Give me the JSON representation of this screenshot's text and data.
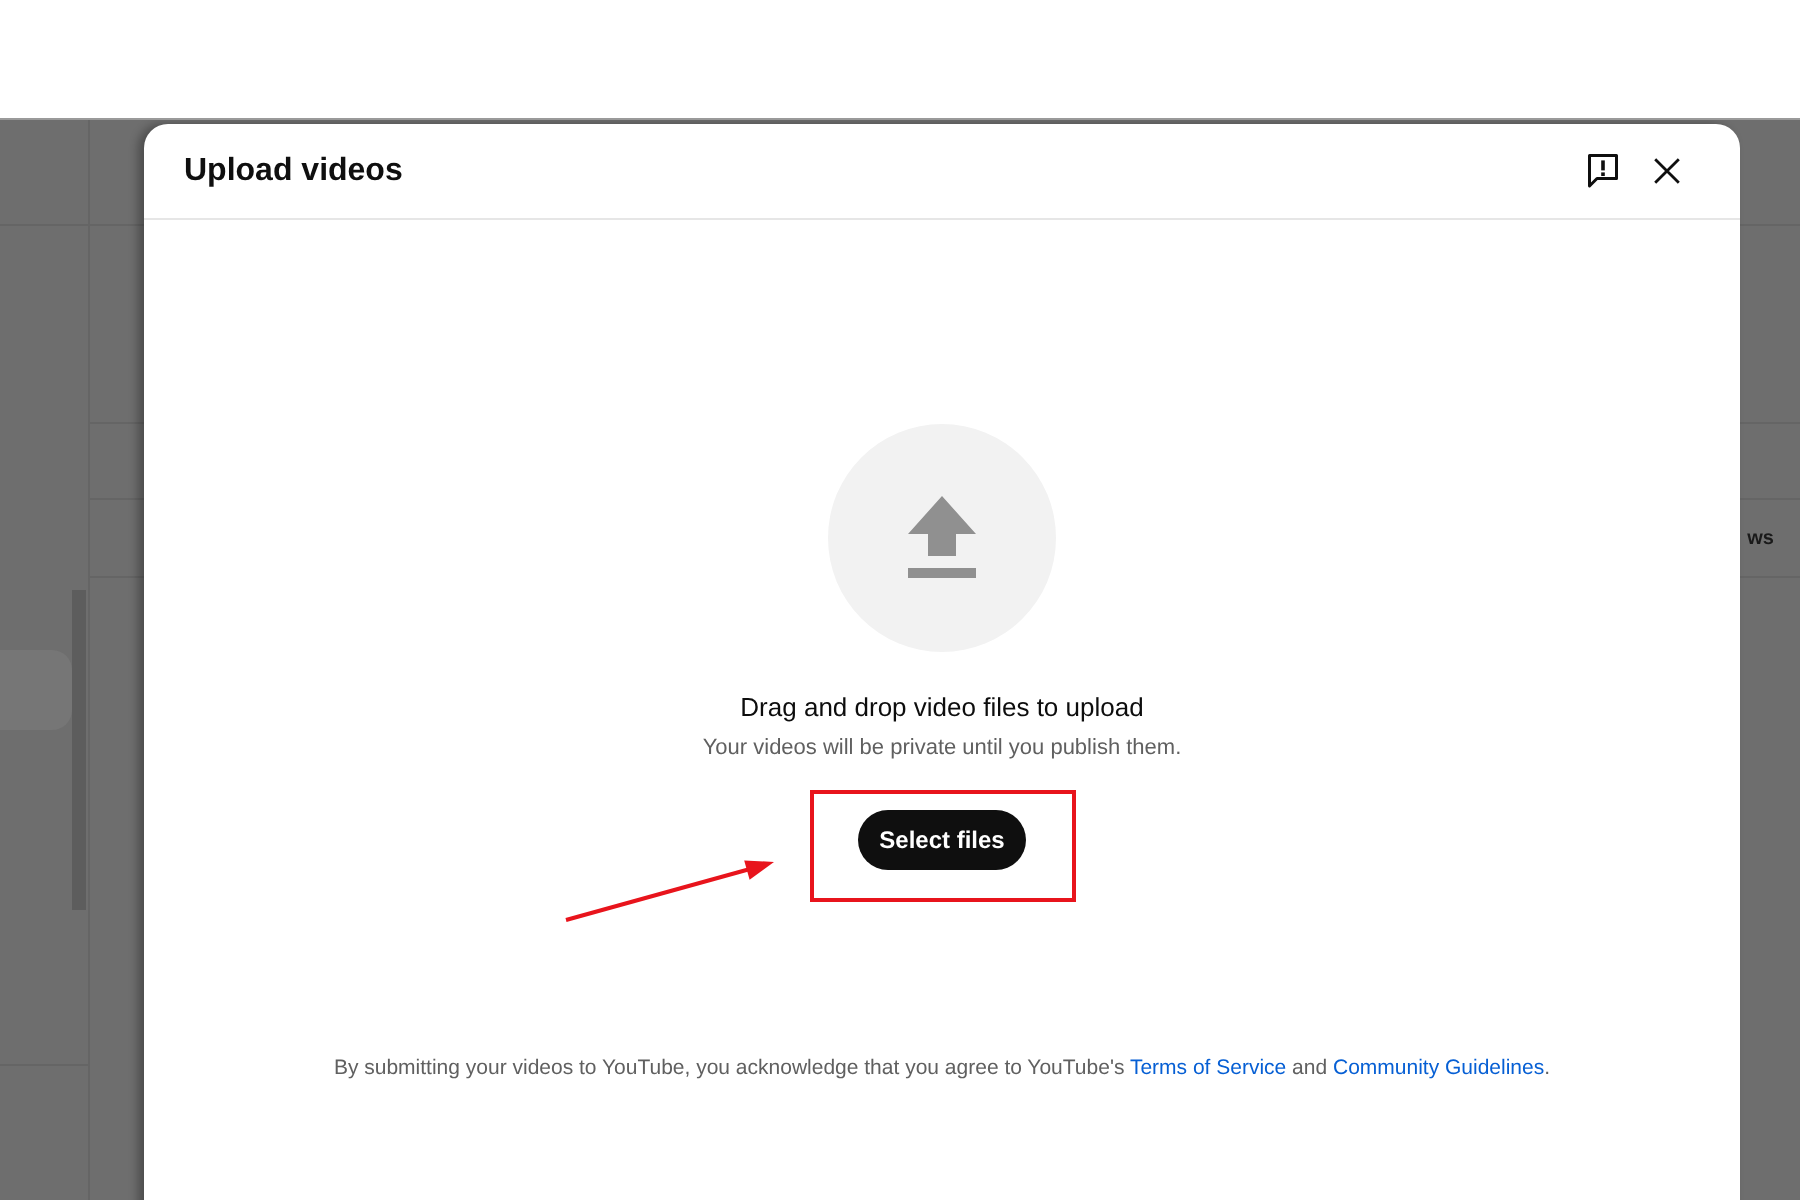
{
  "page_behind": {
    "column_heading": "ws"
  },
  "dialog": {
    "title": "Upload videos",
    "drop_prompt": "Drag and drop video files to upload",
    "privacy_note": "Your videos will be private until you publish them.",
    "select_button": "Select files",
    "legal_notice": [
      {
        "kind": "text",
        "text": "By submitting your videos to YouTube, you acknowledge that you agree to YouTube's "
      },
      {
        "kind": "link",
        "text": "Terms of Service"
      },
      {
        "kind": "text",
        "text": " and "
      },
      {
        "kind": "link",
        "text": "Community Guidelines"
      },
      {
        "kind": "text",
        "text": "."
      }
    ]
  }
}
